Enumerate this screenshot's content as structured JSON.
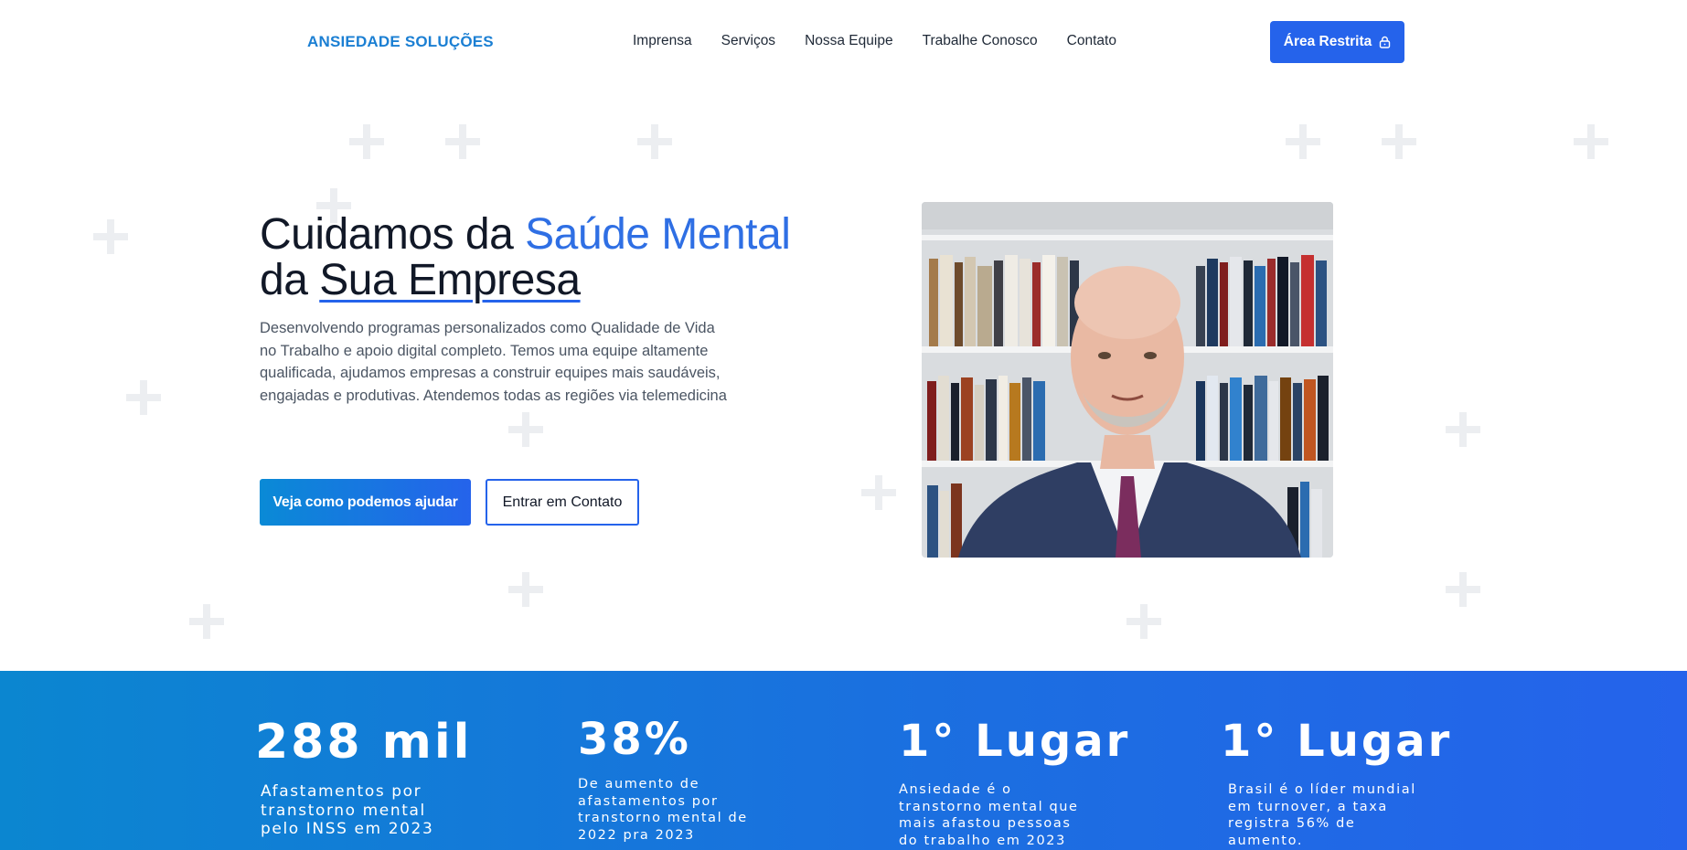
{
  "header": {
    "logo": "ANSIEDADE SOLUÇÕES",
    "menu": [
      "Imprensa",
      "Serviços",
      "Nossa Equipe",
      "Trabalhe Conosco",
      "Contato"
    ],
    "restricted_button": "Área Restrita",
    "restricted_icon": "lock-icon"
  },
  "hero": {
    "title_part1": "Cuidamos da ",
    "title_accent": "Saúde Mental",
    "title_part2": "da ",
    "title_underlined": "Sua Empresa",
    "description": "Desenvolvendo programas personalizados como Qualidade de Vida no Trabalho e apoio digital completo. Temos uma equipe altamente qualificada, ajudamos empresas a construir equipes mais saudáveis, engajadas e produtivas. Atendemos todas as regiões via telemedicina",
    "primary_button": "Veja como podemos ajudar",
    "secondary_button": "Entrar em Contato"
  },
  "stats": [
    {
      "value": "288 mil",
      "label": "Afastamentos por transtorno mental pelo INSS em 2023"
    },
    {
      "value": "38%",
      "label": "De aumento de afastamentos por transtorno mental de 2022 pra 2023"
    },
    {
      "value": "1° Lugar",
      "label": "Ansiedade é o transtorno mental que mais afastou pessoas do trabalho em 2023"
    },
    {
      "value": "1° Lugar",
      "label": "Brasil é o líder mundial em turnover, a taxa registra 56% de aumento."
    }
  ],
  "colors": {
    "accent": "#2563eb",
    "logo": "#1b7fd3",
    "band_start": "#0b86d0",
    "band_end": "#2563eb"
  }
}
